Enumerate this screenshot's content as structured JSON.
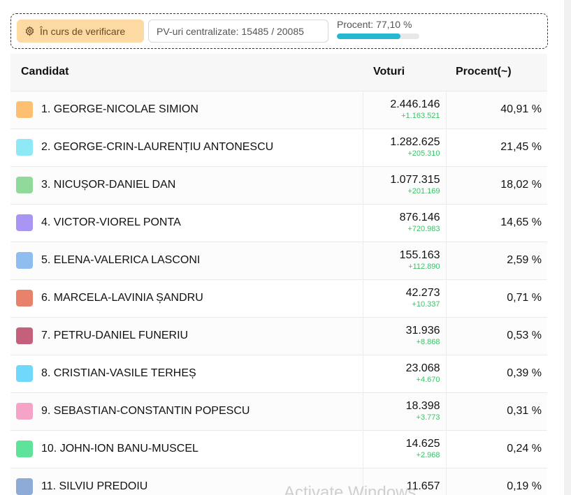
{
  "status": {
    "verify_label": "În curs de verificare",
    "pv_label": "PV-uri centralizate: 15485 / 20085",
    "progress_label": "Procent: 77,10 %",
    "progress_value": 0.771
  },
  "table": {
    "headers": {
      "candidate": "Candidat",
      "votes": "Voturi",
      "percent": "Procent(~)"
    },
    "rows": [
      {
        "name": "1. GEORGE-NICOLAE SIMION",
        "votes": "2.446.146",
        "delta": "+1.163.521",
        "percent": "40,91 %",
        "color": "#fdbf72"
      },
      {
        "name": "2. GEORGE-CRIN-LAURENȚIU ANTONESCU",
        "votes": "1.282.625",
        "delta": "+205.310",
        "percent": "21,45 %",
        "color": "#8fe8f5"
      },
      {
        "name": "3. NICUȘOR-DANIEL DAN",
        "votes": "1.077.315",
        "delta": "+201.169",
        "percent": "18,02 %",
        "color": "#8fd99a"
      },
      {
        "name": "4. VICTOR-VIOREL PONTA",
        "votes": "876.146",
        "delta": "+720.983",
        "percent": "14,65 %",
        "color": "#a996f2"
      },
      {
        "name": "5. ELENA-VALERICA LASCONI",
        "votes": "155.163",
        "delta": "+112.890",
        "percent": "2,59 %",
        "color": "#8fbdf0"
      },
      {
        "name": "6. MARCELA-LAVINIA ȘANDRU",
        "votes": "42.273",
        "delta": "+10.337",
        "percent": "0,71 %",
        "color": "#e8826a"
      },
      {
        "name": "7. PETRU-DANIEL FUNERIU",
        "votes": "31.936",
        "delta": "+8.868",
        "percent": "0,53 %",
        "color": "#c45f7c"
      },
      {
        "name": "8. CRISTIAN-VASILE TERHEȘ",
        "votes": "23.068",
        "delta": "+4.670",
        "percent": "0,39 %",
        "color": "#6fd8fb"
      },
      {
        "name": "9. SEBASTIAN-CONSTANTIN POPESCU",
        "votes": "18.398",
        "delta": "+3.773",
        "percent": "0,31 %",
        "color": "#f5a3c7"
      },
      {
        "name": "10. JOHN-ION BANU-MUSCEL",
        "votes": "14.625",
        "delta": "+2.968",
        "percent": "0,24 %",
        "color": "#5fe39a"
      },
      {
        "name": "11. SILVIU PREDOIU",
        "votes": "11.657",
        "delta": "",
        "percent": "0,19 %",
        "color": "#8eaad6"
      }
    ]
  },
  "watermark": "Activate Windows"
}
